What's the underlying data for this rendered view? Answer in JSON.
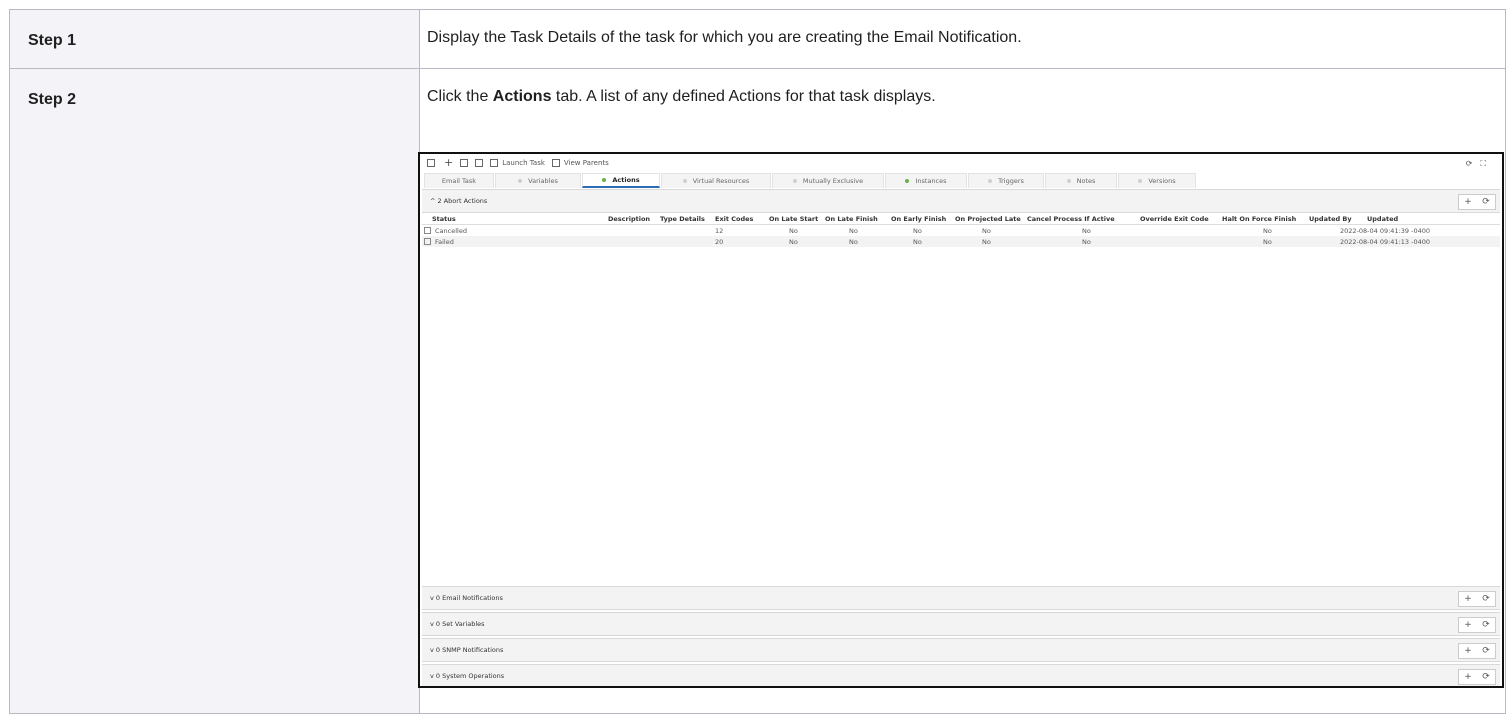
{
  "steps": [
    {
      "label": "Step 1",
      "text": "Display the Task Details of the task for which you are creating the Email Notification."
    },
    {
      "label": "Step 2",
      "text_before": "Click the ",
      "text_bold": "Actions",
      "text_after": " tab. A list of any defined Actions for that task displays."
    }
  ],
  "screenshot": {
    "toolbar": {
      "launch_task": "Launch Task",
      "view_parents": "View Parents"
    },
    "tabs": [
      {
        "label": "Email Task",
        "dot": "none",
        "active": false
      },
      {
        "label": "Variables",
        "dot": "gray",
        "active": false
      },
      {
        "label": "Actions",
        "dot": "green",
        "active": true
      },
      {
        "label": "Virtual Resources",
        "dot": "gray",
        "active": false
      },
      {
        "label": "Mutually Exclusive",
        "dot": "gray",
        "active": false
      },
      {
        "label": "Instances",
        "dot": "green",
        "active": false
      },
      {
        "label": "Triggers",
        "dot": "gray",
        "active": false
      },
      {
        "label": "Notes",
        "dot": "gray",
        "active": false
      },
      {
        "label": "Versions",
        "dot": "gray",
        "active": false
      }
    ],
    "abort_section": {
      "label": "2 Abort Actions",
      "chevron": "^"
    },
    "columns": [
      "Status",
      "Description",
      "Type Details",
      "Exit Codes",
      "On Late Start",
      "On Late Finish",
      "On Early Finish",
      "On Projected Late",
      "Cancel Process If Active",
      "Override Exit Code",
      "Halt On Force Finish",
      "Updated By",
      "Updated"
    ],
    "rows": [
      {
        "status": "Cancelled",
        "exit_codes": "12",
        "on_late_start": "No",
        "on_late_finish": "No",
        "on_early_finish": "No",
        "on_projected_late": "No",
        "cancel_process": "No",
        "halt_on_force_finish": "No",
        "updated": "2022-08-04 09:41:39 -0400"
      },
      {
        "status": "Failed",
        "exit_codes": "20",
        "on_late_start": "No",
        "on_late_finish": "No",
        "on_early_finish": "No",
        "on_projected_late": "No",
        "cancel_process": "No",
        "halt_on_force_finish": "No",
        "updated": "2022-08-04 09:41:13 -0400"
      }
    ],
    "sections": [
      {
        "label": "0 Email Notifications",
        "chevron": "v"
      },
      {
        "label": "0 Set Variables",
        "chevron": "v"
      },
      {
        "label": "0 SNMP Notifications",
        "chevron": "v"
      },
      {
        "label": "0 System Operations",
        "chevron": "v"
      }
    ],
    "section_add": "+",
    "section_refresh": "⟳"
  }
}
